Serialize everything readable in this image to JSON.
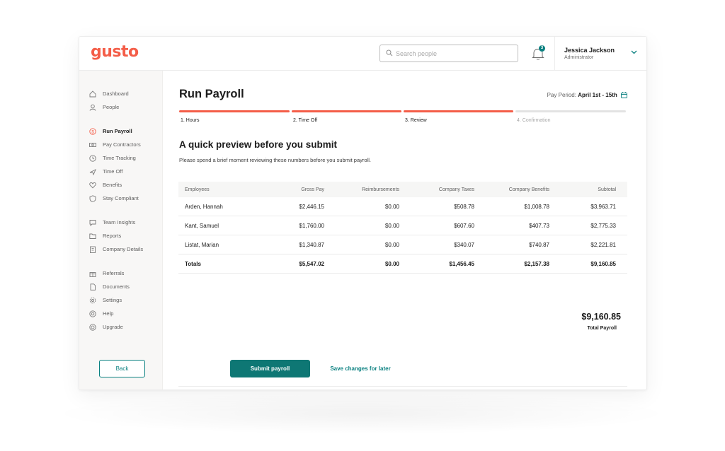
{
  "header": {
    "logo": "gusto",
    "search_placeholder": "Search people",
    "notification_count": "3",
    "user_name": "Jessica Jackson",
    "user_role": "Administrator"
  },
  "sidebar": {
    "items": [
      {
        "label": "Dashboard",
        "icon": "home-icon"
      },
      {
        "label": "People",
        "icon": "person-icon"
      },
      {
        "label": "Run Payroll",
        "icon": "dollar-circle-icon",
        "active": true
      },
      {
        "label": "Pay Contractors",
        "icon": "money-icon"
      },
      {
        "label": "Time Tracking",
        "icon": "clock-icon"
      },
      {
        "label": "Time Off",
        "icon": "plane-icon"
      },
      {
        "label": "Benefits",
        "icon": "heart-icon"
      },
      {
        "label": "Stay Compliant",
        "icon": "shield-icon"
      },
      {
        "label": "Team Insights",
        "icon": "chat-icon"
      },
      {
        "label": "Reports",
        "icon": "folder-icon"
      },
      {
        "label": "Company Details",
        "icon": "building-icon"
      },
      {
        "label": "Referrals",
        "icon": "gift-icon"
      },
      {
        "label": "Documents",
        "icon": "document-icon"
      },
      {
        "label": "Settings",
        "icon": "gear-icon"
      },
      {
        "label": "Help",
        "icon": "help-icon"
      },
      {
        "label": "Upgrade",
        "icon": "upgrade-icon"
      }
    ]
  },
  "main": {
    "title": "Run Payroll",
    "pay_period_label": "Pay Period:",
    "pay_period_value": "April 1st - 15th",
    "steps": [
      {
        "label": "1. Hours",
        "state": "done"
      },
      {
        "label": "2. Time Off",
        "state": "done"
      },
      {
        "label": "3. Review",
        "state": "done"
      },
      {
        "label": "4. Confirmation",
        "state": "todo"
      }
    ],
    "preview_title": "A quick preview before you submit",
    "preview_subtitle": "Please spend a brief moment reviewing these numbers before you submit payroll.",
    "table": {
      "headers": [
        "Employees",
        "Gross Pay",
        "Reimbursements",
        "Company Taxes",
        "Company Benefits",
        "Subtotal"
      ],
      "rows": [
        [
          "Arden, Hannah",
          "$2,446.15",
          "$0.00",
          "$508.78",
          "$1,008.78",
          "$3,963.71"
        ],
        [
          "Kant, Samuel",
          "$1,760.00",
          "$0.00",
          "$607.60",
          "$407.73",
          "$2,775.33"
        ],
        [
          "Listat, Marian",
          "$1,340.87",
          "$0.00",
          "$340.07",
          "$740.87",
          "$2,221.81"
        ]
      ],
      "totals": [
        "Totals",
        "$5,547.02",
        "$0.00",
        "$1,456.45",
        "$2,157.38",
        "$9,160.85"
      ]
    },
    "grand_total": "$9,160.85",
    "grand_total_label": "Total Payroll"
  },
  "footer": {
    "back_label": "Back",
    "submit_label": "Submit payroll",
    "save_label": "Save changes for later"
  },
  "colors": {
    "brand": "#f45d48",
    "teal": "#0e7774",
    "sidebar_bg": "#f8f7f6"
  }
}
